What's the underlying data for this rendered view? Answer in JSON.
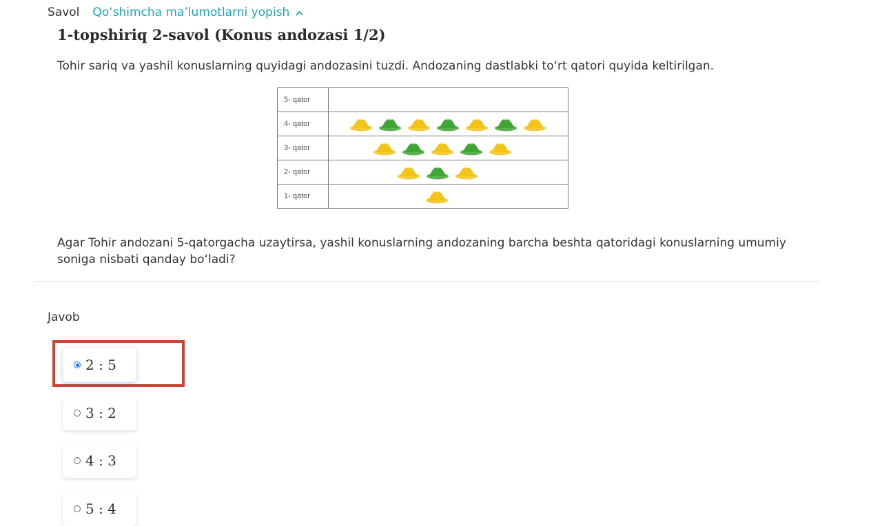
{
  "header": {
    "savol_label": "Savol",
    "toggle_label": "Qo‘shimcha ma’lumotlarni yopish",
    "toggle_icon": "chevron-up-icon"
  },
  "task": {
    "title": "1-topshiriq 2-savol (Konus andozasi 1/2)",
    "intro": "Tohir sariq va yashil konuslarning quyidagi andozasini tuzdi. Andozaning dastlabki to‘rt qatori quyida keltirilgan.",
    "question": "Agar Tohir andozani  5-qatorgacha uzaytirsa, yashil konuslarning andozaning barcha beshta qatoridagi konuslarning umumiy soniga nisbati qanday bo‘ladi?"
  },
  "pattern": {
    "colors": {
      "yellow": "#f2c319",
      "green": "#3fa535"
    },
    "rows": [
      {
        "label": "5- qator",
        "cones": []
      },
      {
        "label": "4- qator",
        "cones": [
          "yellow",
          "green",
          "yellow",
          "green",
          "yellow",
          "green",
          "yellow"
        ]
      },
      {
        "label": "3- qator",
        "cones": [
          "yellow",
          "green",
          "yellow",
          "green",
          "yellow"
        ]
      },
      {
        "label": "2- qator",
        "cones": [
          "yellow",
          "green",
          "yellow"
        ]
      },
      {
        "label": "1-  qator",
        "cones": [
          "yellow"
        ]
      }
    ]
  },
  "answer": {
    "label": "Javob",
    "options": [
      {
        "text": "2 : 5",
        "selected": true
      },
      {
        "text": "3 : 2",
        "selected": false
      },
      {
        "text": "4 : 3",
        "selected": false
      },
      {
        "text": "5 : 4",
        "selected": false
      }
    ]
  }
}
